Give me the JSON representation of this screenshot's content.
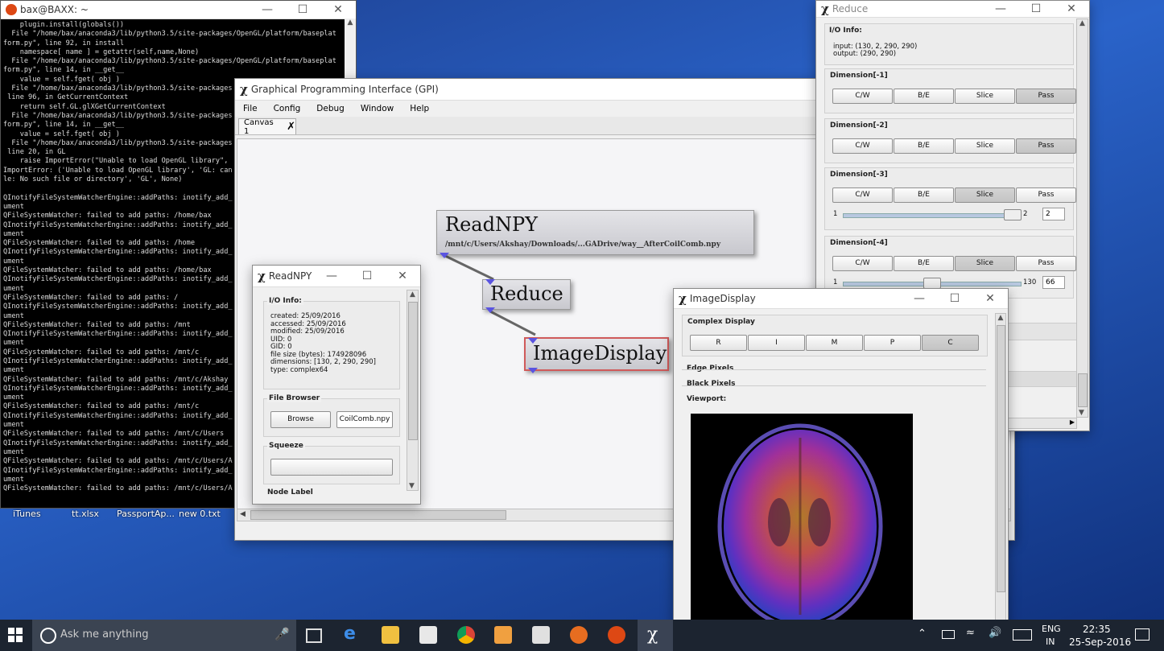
{
  "terminal": {
    "title": "bax@BAXX: ~",
    "lines": [
      "    plugin.install(globals())",
      "  File \"/home/bax/anaconda3/lib/python3.5/site-packages/OpenGL/platform/baseplat",
      "form.py\", line 92, in install",
      "    namespace[ name ] = getattr(self,name,None)",
      "  File \"/home/bax/anaconda3/lib/python3.5/site-packages/OpenGL/platform/baseplat",
      "form.py\", line 14, in __get__",
      "    value = self.fget( obj )",
      "  File \"/home/bax/anaconda3/lib/python3.5/site-packages",
      " line 96, in GetCurrentContext",
      "    return self.GL.glXGetCurrentContext",
      "  File \"/home/bax/anaconda3/lib/python3.5/site-packages",
      "form.py\", line 14, in __get__",
      "    value = self.fget( obj )",
      "  File \"/home/bax/anaconda3/lib/python3.5/site-packages",
      " line 20, in GL",
      "    raise ImportError(\"Unable to load OpenGL library\",",
      "ImportError: ('Unable to load OpenGL library', 'GL: can",
      "le: No such file or directory', 'GL', None)",
      "",
      "QInotifyFileSystemWatcherEngine::addPaths: inotify_add_",
      "ument",
      "QFileSystemWatcher: failed to add paths: /home/bax",
      "QInotifyFileSystemWatcherEngine::addPaths: inotify_add_",
      "ument",
      "QFileSystemWatcher: failed to add paths: /home",
      "QInotifyFileSystemWatcherEngine::addPaths: inotify_add_",
      "ument",
      "QFileSystemWatcher: failed to add paths: /home/bax",
      "QInotifyFileSystemWatcherEngine::addPaths: inotify_add_",
      "ument",
      "QFileSystemWatcher: failed to add paths: /",
      "QInotifyFileSystemWatcherEngine::addPaths: inotify_add_",
      "ument",
      "QFileSystemWatcher: failed to add paths: /mnt",
      "QInotifyFileSystemWatcherEngine::addPaths: inotify_add_",
      "ument",
      "QFileSystemWatcher: failed to add paths: /mnt/c",
      "QInotifyFileSystemWatcherEngine::addPaths: inotify_add_",
      "ument",
      "QFileSystemWatcher: failed to add paths: /mnt/c/Akshay",
      "QInotifyFileSystemWatcherEngine::addPaths: inotify_add_",
      "ument",
      "QFileSystemWatcher: failed to add paths: /mnt/c",
      "QInotifyFileSystemWatcherEngine::addPaths: inotify_add_",
      "ument",
      "QFileSystemWatcher: failed to add paths: /mnt/c/Users",
      "QInotifyFileSystemWatcherEngine::addPaths: inotify_add_",
      "ument",
      "QFileSystemWatcher: failed to add paths: /mnt/c/Users/A",
      "QInotifyFileSystemWatcherEngine::addPaths: inotify_add_",
      "ument",
      "QFileSystemWatcher: failed to add paths: /mnt/c/Users/A"
    ]
  },
  "desktop_labels": [
    "iTunes",
    "tt.xlsx",
    "PassportAp...",
    "new  0.txt"
  ],
  "gpi": {
    "title": "Graphical Programming Interface (GPI)",
    "menu": [
      "File",
      "Config",
      "Debug",
      "Window",
      "Help"
    ],
    "tab_label": "Canvas 1",
    "nodes": {
      "readnpy": {
        "name": "ReadNPY",
        "path": "/mnt/c/Users/Akshay/Downloads/...GADrive/way__AfterCoilComb.npy"
      },
      "reduce": {
        "name": "Reduce"
      },
      "imagedisplay": {
        "name": "ImageDisplay"
      }
    }
  },
  "readnpy_dialog": {
    "title": "ReadNPY",
    "io_info_label": "I/O Info:",
    "info_lines": [
      "created: 25/09/2016",
      "accessed: 25/09/2016",
      "modified: 25/09/2016",
      "UID: 0",
      "GID: 0",
      "file size (bytes): 174928096",
      "dimensions: [130, 2, 290, 290]",
      "type: complex64"
    ],
    "file_browser_label": "File Browser",
    "browse_label": "Browse",
    "file_value": "CoilComb.npy",
    "squeeze_label": "Squeeze",
    "node_label_label": "Node Label"
  },
  "reduce_dialog": {
    "title": "Reduce",
    "io_info_label": "I/O Info:",
    "input_line": "input: (130, 2, 290, 290)",
    "output_line": "output: (290, 290)",
    "button_labels": [
      "C/W",
      "B/E",
      "Slice",
      "Pass"
    ],
    "dims": [
      {
        "label": "Dimension[-1]",
        "selected": "Pass"
      },
      {
        "label": "Dimension[-2]",
        "selected": "Pass"
      },
      {
        "label": "Dimension[-3]",
        "selected": "Slice",
        "min": "1",
        "max": "2",
        "value": "2",
        "fraction": 1.0
      },
      {
        "label": "Dimension[-4]",
        "selected": "Slice",
        "min": "1",
        "max": "130",
        "value": "66",
        "fraction": 0.5
      }
    ]
  },
  "imagedisplay_dialog": {
    "title": "ImageDisplay",
    "complex_display_label": "Complex Display",
    "complex_buttons": [
      "R",
      "I",
      "M",
      "P",
      "C"
    ],
    "complex_selected": "C",
    "edge_pixels_label": "Edge Pixels",
    "black_pixels_label": "Black Pixels",
    "viewport_label": "Viewport:"
  },
  "taskbar": {
    "search_placeholder": "Ask me anything",
    "lang_top": "ENG",
    "lang_bottom": "IN",
    "time": "22:35",
    "date": "25-Sep-2016"
  }
}
